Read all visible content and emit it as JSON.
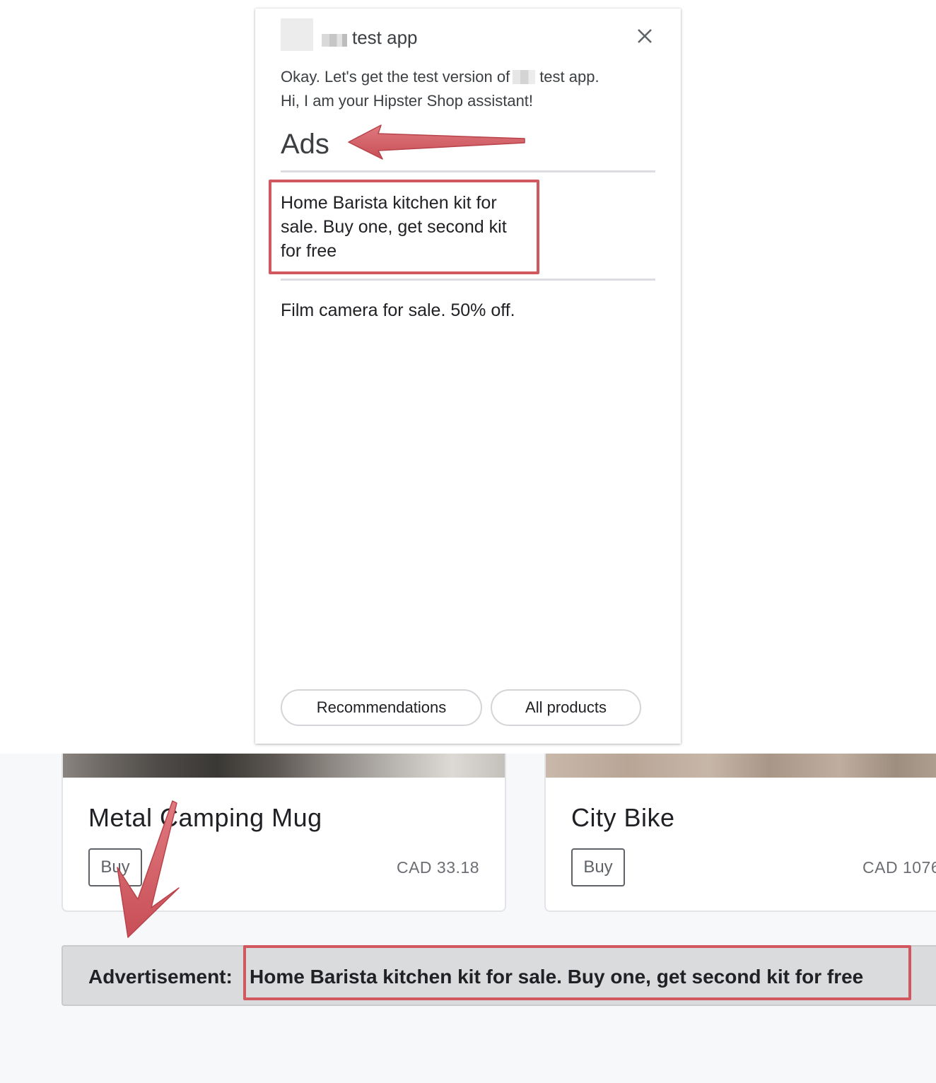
{
  "assistant": {
    "app_name": "test app",
    "message_line1_before": "Okay. Let's get the test version of",
    "message_line1_after": "test app.",
    "message_line2": "Hi, I am your Hipster Shop assistant!",
    "ads_title": "Ads",
    "ads": [
      "Home Barista kitchen kit for sale. Buy one, get second kit for free",
      "Film camera for sale. 50% off."
    ],
    "chips": [
      "Recommendations",
      "All products"
    ]
  },
  "products": [
    {
      "name": "Metal Camping Mug",
      "buy_label": "Buy",
      "price": "CAD 33.18"
    },
    {
      "name": "City Bike",
      "buy_label": "Buy",
      "price": "CAD 1076"
    }
  ],
  "ad_banner": {
    "label": "Advertisement:",
    "text": "Home Barista kitchen kit for sale. Buy one, get second kit for free"
  },
  "annotation": {
    "highlight_color": "#d1585f"
  }
}
